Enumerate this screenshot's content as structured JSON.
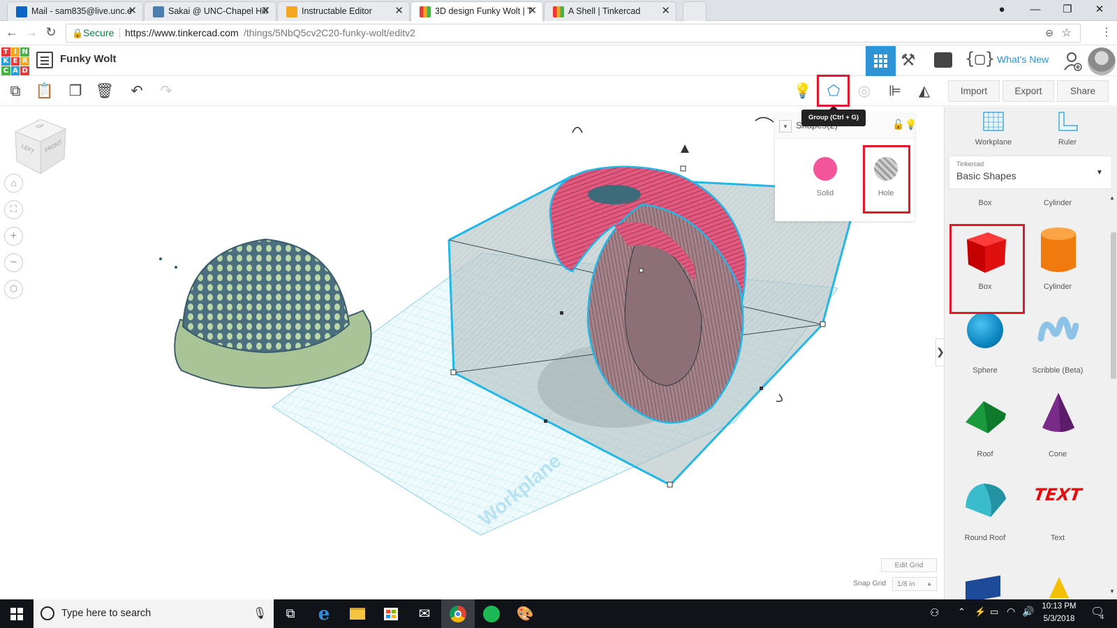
{
  "browser": {
    "tabs": [
      {
        "title": "Mail - sam835@live.unc.e",
        "favicon": "outlook-icon",
        "color": "#0a66c2"
      },
      {
        "title": "Sakai @ UNC-Chapel Hill",
        "favicon": "sakai-icon",
        "color": "#4a7fb0"
      },
      {
        "title": "Instructable Editor",
        "favicon": "instructables-icon",
        "color": "#f5a623"
      },
      {
        "title": "3D design Funky Wolt | T",
        "favicon": "tinkercad-icon",
        "color": "#e83a3a"
      },
      {
        "title": "A Shell | Tinkercad",
        "favicon": "tinkercad-icon",
        "color": "#e83a3a"
      }
    ],
    "secure_label": "Secure",
    "url_base": "https://www.tinkercad.com",
    "url_path": "/things/5NbQ5cv2C20-funky-wolt/editv2"
  },
  "app": {
    "design_name": "Funky Wolt",
    "whats_new": "What's New",
    "logo_letters": [
      "T",
      "I",
      "N",
      "K",
      "E",
      "R",
      "C",
      "A",
      "D"
    ],
    "logo_colors": [
      "#e83a3a",
      "#f5a623",
      "#47b349",
      "#2a9fd6",
      "#e83a3a",
      "#f5a623",
      "#47b349",
      "#2a9fd6",
      "#e83a3a"
    ]
  },
  "toolbar": {
    "import": "Import",
    "export": "Export",
    "share": "Share",
    "group_tooltip": "Group (Ctrl + G)"
  },
  "inspector": {
    "title": "Shapes(2)",
    "solid": "Solid",
    "hole": "Hole",
    "solid_color": "#f2559a"
  },
  "viewport": {
    "view_cube": {
      "top": "TOP",
      "left": "LEFT",
      "front": "FRONT"
    },
    "workplane_label": "Workplane",
    "edit_grid": "Edit Grid",
    "snap_grid_label": "Snap Grid",
    "snap_grid_value": "1/8 in"
  },
  "panel": {
    "workplane": "Workplane",
    "ruler": "Ruler",
    "library_source": "Tinkercad",
    "library_name": "Basic Shapes",
    "shapes": [
      {
        "label": "Box"
      },
      {
        "label": "Cylinder"
      },
      {
        "label": "Box"
      },
      {
        "label": "Cylinder"
      },
      {
        "label": "Sphere"
      },
      {
        "label": "Scribble (Beta)"
      },
      {
        "label": "Roof"
      },
      {
        "label": "Cone"
      },
      {
        "label": "Round Roof"
      },
      {
        "label": "Text"
      }
    ]
  },
  "taskbar": {
    "search_placeholder": "Type here to search",
    "time": "10:13 PM",
    "date": "5/3/2018",
    "notification_count": "4"
  }
}
